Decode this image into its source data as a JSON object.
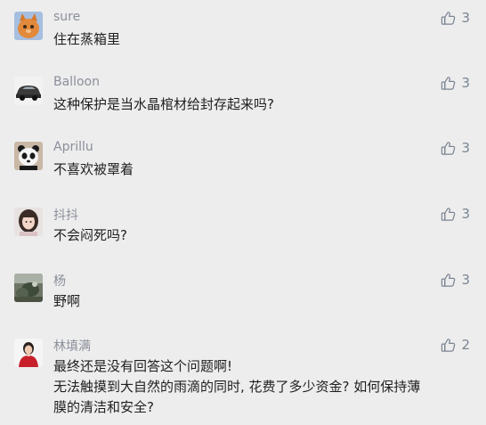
{
  "comments": [
    {
      "name": "sure",
      "lines": [
        "住在蒸箱里"
      ],
      "likes": "3",
      "avatar": "orange-cat-avatar"
    },
    {
      "name": "Balloon",
      "lines": [
        "这种保护是当水晶棺材给封存起来吗?"
      ],
      "likes": "3",
      "avatar": "car-avatar"
    },
    {
      "name": "Aprillu",
      "lines": [
        "不喜欢被罩着"
      ],
      "likes": "3",
      "avatar": "panda-avatar"
    },
    {
      "name": "抖抖",
      "lines": [
        "不会闷死吗?"
      ],
      "likes": "3",
      "avatar": "girl-avatar"
    },
    {
      "name": "杨",
      "lines": [
        "野啊"
      ],
      "likes": "3",
      "avatar": "landscape-avatar"
    },
    {
      "name": "林填满",
      "lines": [
        "最终还是没有回答这个问题啊!",
        "无法触摸到大自然的雨滴的同时, 花费了多少资金? 如何保持薄",
        "膜的清洁和安全?"
      ],
      "likes": "2",
      "avatar": "person-red-avatar"
    }
  ],
  "colors": {
    "background": "#ededed",
    "name": "#8a8f9a",
    "text": "#1f1f1f",
    "like": "#7b8593"
  }
}
